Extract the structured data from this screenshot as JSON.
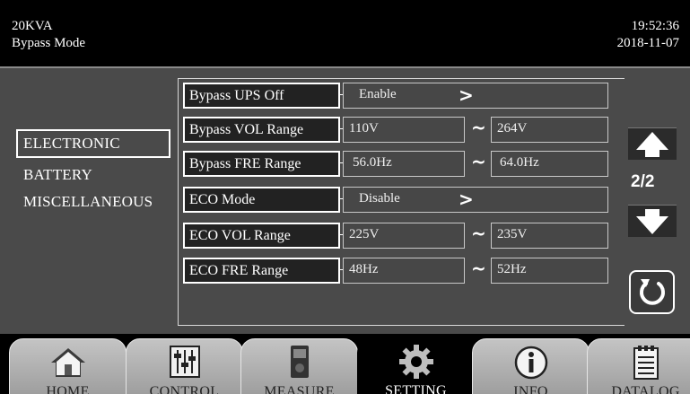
{
  "header": {
    "model": "20KVA",
    "mode": "Bypass Mode",
    "time": "19:52:36",
    "date": "2018-11-07"
  },
  "categories": {
    "electronic": "ELECTRONIC",
    "battery": "BATTERY",
    "miscellaneous": "MISCELLANEOUS",
    "selected": "ELECTRONIC"
  },
  "settings": [
    {
      "label": "Bypass UPS Off",
      "value": "Enable"
    },
    {
      "label": "Bypass VOL Range",
      "min": "110V",
      "max": "264V"
    },
    {
      "label": "Bypass FRE Range",
      "min": "56.0Hz",
      "max": "64.0Hz"
    },
    {
      "label": "ECO Mode",
      "value": "Disable"
    },
    {
      "label": "ECO VOL Range",
      "min": "225V",
      "max": "235V"
    },
    {
      "label": "ECO FRE Range",
      "min": "48Hz",
      "max": "52Hz"
    }
  ],
  "range_separator": "~",
  "enum_arrow": ">",
  "paging": {
    "indicator": "2/2"
  },
  "icons": {
    "scroll_up": "arrow-up-icon",
    "scroll_down": "arrow-down-icon",
    "refresh": "refresh-icon"
  },
  "tabs": [
    {
      "label": "HOME",
      "icon": "home-icon"
    },
    {
      "label": "CONTROL",
      "icon": "sliders-icon"
    },
    {
      "label": "MEASURE",
      "icon": "meter-icon"
    },
    {
      "label": "SETTING",
      "icon": "gear-icon",
      "active": true
    },
    {
      "label": "INFO",
      "icon": "info-icon"
    },
    {
      "label": "DATALOG",
      "icon": "clipboard-icon"
    }
  ]
}
